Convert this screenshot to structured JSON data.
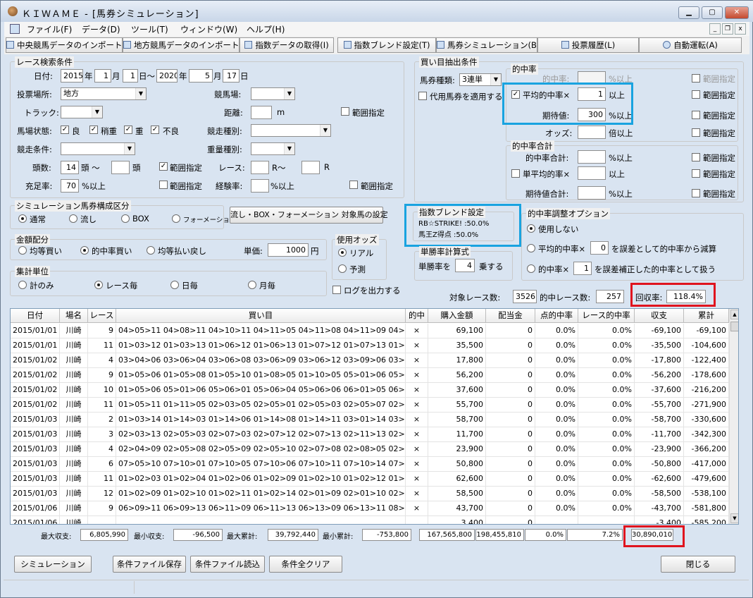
{
  "window": {
    "title": "ＫＩＷＡＭＥ - [馬券シミュレーション]"
  },
  "menu": [
    "ファイル(F)",
    "データ(D)",
    "ツール(T)",
    "ウィンドウ(W)",
    "ヘルプ(H)"
  ],
  "toolbar": [
    "中央競馬データのインポート(J)",
    "地方競馬データのインポート(N)",
    "指数データの取得(I)",
    "指数ブレンド設定(T)",
    "馬券シミュレーション(B)",
    "投票履歴(L)",
    "自動運転(A)"
  ],
  "race": {
    "group": "レース検索条件",
    "date_label": "日付:",
    "from_y": "2015",
    "from_m": "1",
    "from_d": "1",
    "to_y": "2020",
    "to_m": "5",
    "to_d": "17",
    "u_year": "年",
    "u_month": "月",
    "u_day": "日",
    "u_tilde": "日〜",
    "venue_label": "投票場所:",
    "venue": "地方",
    "track_label": "競馬場:",
    "trackkind_label": "トラック:",
    "distance_label": "距離:",
    "distance_unit": "m",
    "range": "範囲指定",
    "cond_label": "馬場状態:",
    "cond": [
      "良",
      "稍重",
      "重",
      "不良"
    ],
    "racetype_label": "競走種別:",
    "racecond_label": "競走条件:",
    "weight_label": "重量種別:",
    "heads_label": "頭数:",
    "heads_from": "14",
    "heads_unit1": "頭 〜",
    "heads_unit2": "頭",
    "raceno_label": "レース:",
    "r1": "R〜",
    "r2": "R",
    "fill_label": "充足率:",
    "fill": "70",
    "fill_unit": "%以上",
    "exp_label": "経験率:",
    "exp_unit": "%以上"
  },
  "sim": {
    "group": "シミュレーション馬券構成区分",
    "opts": [
      "通常",
      "流し",
      "BOX",
      "フォーメーション"
    ],
    "button": "流し・BOX・フォーメーション 対象馬の設定"
  },
  "money": {
    "group": "金額配分",
    "opts": [
      "均等買い",
      "的中率買い",
      "均等払い戻し"
    ],
    "unit_label": "単価:",
    "unit_value": "1000",
    "unit_suffix": "円"
  },
  "odds": {
    "group": "使用オッズ",
    "opts": [
      "リアル",
      "予測"
    ]
  },
  "agg": {
    "group": "集計単位",
    "opts": [
      "計のみ",
      "レース毎",
      "日毎",
      "月毎"
    ],
    "log": "ログを出力する"
  },
  "bet": {
    "group": "買い目抽出条件",
    "type_label": "馬券種類:",
    "type": "3連単",
    "proxy": "代用馬券を適用する"
  },
  "hit": {
    "group": "的中率",
    "rate_label": "的中率:",
    "over": "%以上",
    "avg_label": "平均的中率×",
    "avg_value": "1",
    "avg_unit": "以上",
    "ev_label": "期待値:",
    "ev_value": "300",
    "odds_label": "オッズ:",
    "odds_unit": "倍以上",
    "range": "範囲指定"
  },
  "hitsum": {
    "group": "的中率合計",
    "sum_label": "的中率合計:",
    "single_label": "単平均的率×",
    "single_unit": "以上",
    "ev_label": "期待値合計:",
    "over": "%以上"
  },
  "blend": {
    "group": "指数ブレンド設定",
    "line1": "RB☆STRIKE! :50.0%",
    "line2": "馬王Z得点 :50.0%"
  },
  "winrate": {
    "group": "単勝率計算式",
    "prefix": "単勝率を",
    "value": "4",
    "suffix": "乗する"
  },
  "adjust": {
    "group": "的中率調整オプション",
    "opt1": "使用しない",
    "opt2a": "平均的中率×",
    "opt2v": "0",
    "opt2b": "を誤差として的中率から減算",
    "opt3a": "的中率×",
    "opt3v": "1",
    "opt3b": "を誤差補正した的中率として扱う"
  },
  "stats": {
    "races_label": "対象レース数:",
    "races": "3526",
    "hits_label": "的中レース数:",
    "hits": "257",
    "recovery_label": "回収率:",
    "recovery": "118.4%"
  },
  "grid": {
    "headers": [
      "日付",
      "場名",
      "レース",
      "買い目",
      "的中",
      "購入金額",
      "配当金",
      "点的中率",
      "レース的中率",
      "収支",
      "累計"
    ],
    "rows": [
      [
        "2015/01/01",
        "川崎",
        "9",
        "04>05>11 04>08>11 04>10>11 04>11>05 04>11>08 04>11>09 04>11>10 05>0",
        "×",
        "69,100",
        "0",
        "0.0%",
        "0.0%",
        "-69,100",
        "-69,100"
      ],
      [
        "2015/01/01",
        "川崎",
        "11",
        "01>03>12 01>03>13 01>06>12 01>06>13 01>07>12 01>07>13 01>12>03 01>1",
        "×",
        "35,500",
        "0",
        "0.0%",
        "0.0%",
        "-35,500",
        "-104,600"
      ],
      [
        "2015/01/02",
        "川崎",
        "4",
        "03>04>06 03>06>04 03>06>08 03>06>09 03>06>12 03>09>06 03>12>06 04>0",
        "×",
        "17,800",
        "0",
        "0.0%",
        "0.0%",
        "-17,800",
        "-122,400"
      ],
      [
        "2015/01/02",
        "川崎",
        "9",
        "01>05>06 01>05>08 01>05>10 01>08>05 01>10>05 05>01>06 05>01>08 05>0",
        "×",
        "56,200",
        "0",
        "0.0%",
        "0.0%",
        "-56,200",
        "-178,600"
      ],
      [
        "2015/01/02",
        "川崎",
        "10",
        "01>05>06 05>01>06 05>06>01 05>06>04 05>06>06 06>01>05 06>05>01 06>0",
        "×",
        "37,600",
        "0",
        "0.0%",
        "0.0%",
        "-37,600",
        "-216,200"
      ],
      [
        "2015/01/02",
        "川崎",
        "11",
        "01>05>11 01>11>05 02>03>05 02>05>01 02>05>03 02>05>07 02>05>10 02>0",
        "×",
        "55,700",
        "0",
        "0.0%",
        "0.0%",
        "-55,700",
        "-271,900"
      ],
      [
        "2015/01/03",
        "川崎",
        "2",
        "01>03>14 01>14>03 01>14>06 01>14>08 01>14>11 03>01>14 03>14>01 03>1",
        "×",
        "58,700",
        "0",
        "0.0%",
        "0.0%",
        "-58,700",
        "-330,600"
      ],
      [
        "2015/01/03",
        "川崎",
        "3",
        "02>03>13 02>05>03 02>07>03 02>07>12 02>07>13 02>11>13 02>12>07 02>1",
        "×",
        "11,700",
        "0",
        "0.0%",
        "0.0%",
        "-11,700",
        "-342,300"
      ],
      [
        "2015/01/03",
        "川崎",
        "4",
        "02>04>09 02>05>08 02>05>09 02>05>10 02>07>08 02>08>05 02>08>07 02>0",
        "×",
        "23,900",
        "0",
        "0.0%",
        "0.0%",
        "-23,900",
        "-366,200"
      ],
      [
        "2015/01/03",
        "川崎",
        "6",
        "07>05>10 07>10>01 07>10>05 07>10>06 07>10>11 07>10>14 07>11>10 10>0",
        "×",
        "50,800",
        "0",
        "0.0%",
        "0.0%",
        "-50,800",
        "-417,000"
      ],
      [
        "2015/01/03",
        "川崎",
        "11",
        "01>02>03 01>02>04 01>02>06 01>02>09 01>02>10 01>02>12 01>02>14 01>0",
        "×",
        "62,600",
        "0",
        "0.0%",
        "0.0%",
        "-62,600",
        "-479,600"
      ],
      [
        "2015/01/03",
        "川崎",
        "12",
        "01>02>09 01>02>10 01>02>11 01>02>14 02>01>09 02>01>10 02>01>11 02>0",
        "×",
        "58,500",
        "0",
        "0.0%",
        "0.0%",
        "-58,500",
        "-538,100"
      ],
      [
        "2015/01/06",
        "川崎",
        "9",
        "06>09>11 06>09>13 06>11>09 06>11>13 06>13>09 06>13>11 08>09>13 08>1",
        "×",
        "43,700",
        "0",
        "0.0%",
        "0.0%",
        "-43,700",
        "-581,800"
      ],
      [
        "2015/01/06",
        "川崎",
        "",
        "",
        "",
        "3,400",
        "0",
        "",
        "",
        "-3,400",
        "-585,200"
      ]
    ]
  },
  "summary": {
    "max_label": "最大収支:",
    "max": "6,805,990",
    "min_label": "最小収支:",
    "min": "-96,500",
    "maxcum_label": "最大累計:",
    "maxcum": "39,792,440",
    "mincum_label": "最小累計:",
    "mincum": "-753,800",
    "buy": "167,565,800",
    "pay": "198,455,810",
    "pt": "0.0%",
    "race": "7.2%",
    "total": "30,890,010"
  },
  "footer": {
    "simulate": "シミュレーション",
    "save": "条件ファイル保存",
    "load": "条件ファイル読込",
    "clear": "条件全クリア",
    "close": "閉じる"
  }
}
